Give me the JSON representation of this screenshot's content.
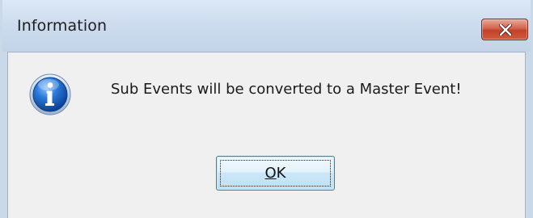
{
  "window": {
    "title": "Information"
  },
  "message": {
    "text": "Sub Events will be converted to a Master Event!"
  },
  "buttons": {
    "ok_mnemonic": "O",
    "ok_rest": "K"
  },
  "icons": {
    "dialog_icon": "information-icon",
    "close": "close-icon"
  }
}
